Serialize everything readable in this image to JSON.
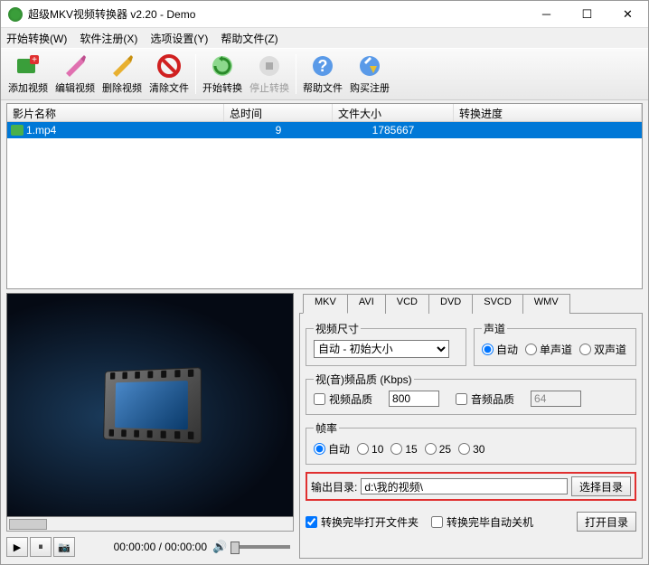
{
  "title": "超级MKV视频转换器 v2.20 - Demo",
  "menu": {
    "start": "开始转换(W)",
    "register": "软件注册(X)",
    "options": "选项设置(Y)",
    "help": "帮助文件(Z)"
  },
  "toolbar": {
    "add": "添加视频",
    "edit": "编辑视频",
    "del": "删除视频",
    "clear": "清除文件",
    "start": "开始转换",
    "stop": "停止转换",
    "help": "帮助文件",
    "buy": "购买注册"
  },
  "columns": {
    "name": "影片名称",
    "time": "总时间",
    "size": "文件大小",
    "prog": "转换进度"
  },
  "row": {
    "name": "1.mp4",
    "time": "9",
    "size": "1785667"
  },
  "player": {
    "time": "00:00:00 / 00:00:00"
  },
  "tabs": {
    "mkv": "MKV",
    "avi": "AVI",
    "vcd": "VCD",
    "dvd": "DVD",
    "svcd": "SVCD",
    "wmv": "WMV"
  },
  "size": {
    "legend": "视频尺寸",
    "value": "自动 - 初始大小"
  },
  "channel": {
    "legend": "声道",
    "auto": "自动",
    "mono": "单声道",
    "stereo": "双声道"
  },
  "quality": {
    "legend": "视(音)频品质 (Kbps)",
    "video_label": "视频品质",
    "video_val": "800",
    "audio_label": "音频品质",
    "audio_val": "64"
  },
  "rate": {
    "legend": "帧率",
    "auto": "自动",
    "r10": "10",
    "r15": "15",
    "r25": "25",
    "r30": "30"
  },
  "output": {
    "label": "输出目录:",
    "path": "d:\\我的视频\\",
    "choose": "选择目录"
  },
  "bottom": {
    "open_folder": "转换完毕打开文件夹",
    "shutdown": "转换完毕自动关机",
    "open_dir": "打开目录"
  }
}
